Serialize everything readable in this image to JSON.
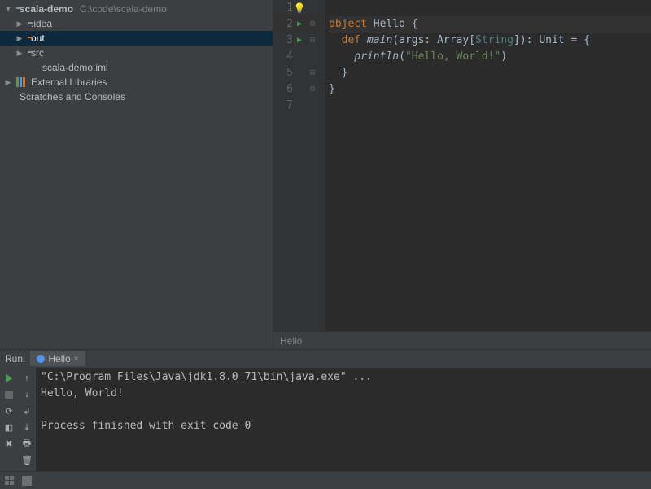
{
  "project": {
    "name": "scala-demo",
    "path": "C:\\code\\scala-demo",
    "items": [
      {
        "label": ".idea"
      },
      {
        "label": "out"
      },
      {
        "label": "src"
      },
      {
        "label": "scala-demo.iml"
      }
    ],
    "external_libs": "External Libraries",
    "scratches": "Scratches and Consoles"
  },
  "editor": {
    "lines": {
      "1": "1",
      "2": "2",
      "3": "3",
      "4": "4",
      "5": "5",
      "6": "6",
      "7": "7"
    },
    "tokens": {
      "object": "object",
      "hello": "Hello",
      "brace_o": "{",
      "brace_c": "}",
      "def": "def",
      "main": "main",
      "args": "args",
      "array": "Array",
      "string": "String",
      "unit": "Unit",
      "eq": "=",
      "println": "println",
      "msg": "\"Hello, World!\""
    },
    "breadcrumb": "Hello"
  },
  "run": {
    "label": "Run:",
    "tab": "Hello",
    "output": {
      "cmd": "\"C:\\Program Files\\Java\\jdk1.8.0_71\\bin\\java.exe\" ...",
      "line1": "Hello, World!",
      "blank": "",
      "line2": "Process finished with exit code 0"
    }
  }
}
